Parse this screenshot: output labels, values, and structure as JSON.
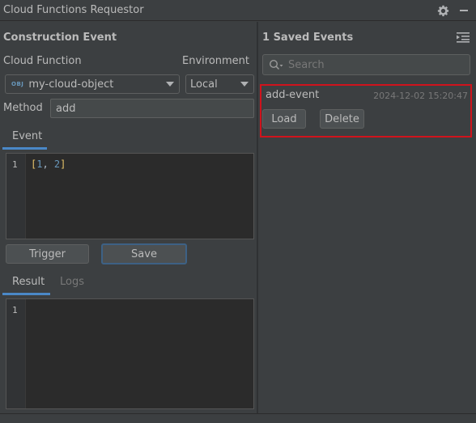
{
  "window": {
    "title": "Cloud Functions Requestor"
  },
  "left": {
    "section_title": "Construction Event",
    "cloud_function_label": "Cloud Function",
    "environment_label": "Environment",
    "cloud_function": {
      "badge": "OBJ",
      "value": "my-cloud-object"
    },
    "environment": {
      "value": "Local"
    },
    "method_label": "Method",
    "method_value": "add",
    "event_tab": "Event",
    "event_editor": {
      "line_number": "1",
      "code": {
        "open": "[",
        "first": "1",
        "sep": ", ",
        "second": "2",
        "close": "]"
      }
    },
    "trigger_button": "Trigger",
    "save_button": "Save",
    "result_tab": "Result",
    "logs_tab": "Logs",
    "result_editor": {
      "line_number": "1"
    }
  },
  "right": {
    "header": "1 Saved Events",
    "search": {
      "placeholder": "Search"
    },
    "saved_events": [
      {
        "name": "add-event",
        "date": "2024-12-02 15:20:47",
        "load_label": "Load",
        "delete_label": "Delete"
      }
    ]
  },
  "colors": {
    "accent": "#4a88c7",
    "highlight_border": "#d0131c",
    "background": "#3c3f41",
    "editor_bg": "#2b2b2b"
  },
  "icons": [
    "settings-gear-icon",
    "minimize-icon",
    "expand-list-icon",
    "search-icon",
    "dropdown-arrow-icon"
  ]
}
